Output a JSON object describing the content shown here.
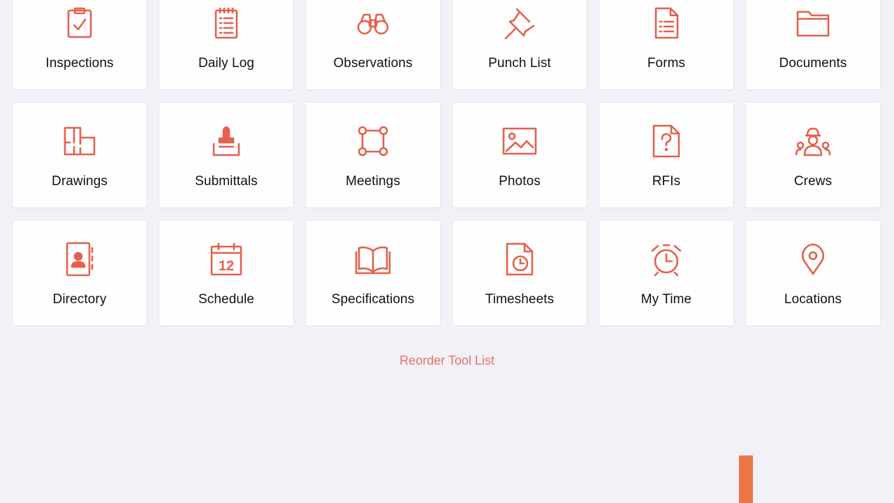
{
  "accent_color": "#e5604e",
  "tools": [
    {
      "label": "Inspections",
      "icon": "clipboard-check-icon"
    },
    {
      "label": "Daily Log",
      "icon": "notepad-icon"
    },
    {
      "label": "Observations",
      "icon": "binoculars-icon"
    },
    {
      "label": "Punch List",
      "icon": "pushpin-icon"
    },
    {
      "label": "Forms",
      "icon": "form-document-icon"
    },
    {
      "label": "Documents",
      "icon": "folder-icon"
    },
    {
      "label": "Drawings",
      "icon": "floorplan-icon"
    },
    {
      "label": "Submittals",
      "icon": "stamp-icon"
    },
    {
      "label": "Meetings",
      "icon": "meeting-nodes-icon"
    },
    {
      "label": "Photos",
      "icon": "image-icon"
    },
    {
      "label": "RFIs",
      "icon": "question-document-icon"
    },
    {
      "label": "Crews",
      "icon": "crew-hardhat-icon"
    },
    {
      "label": "Directory",
      "icon": "contact-book-icon"
    },
    {
      "label": "Schedule",
      "icon": "calendar-icon"
    },
    {
      "label": "Specifications",
      "icon": "open-book-icon"
    },
    {
      "label": "Timesheets",
      "icon": "clock-document-icon"
    },
    {
      "label": "My Time",
      "icon": "alarm-clock-icon"
    },
    {
      "label": "Locations",
      "icon": "map-pin-icon"
    }
  ],
  "calendar_day": "12",
  "reorder_label": "Reorder Tool List"
}
